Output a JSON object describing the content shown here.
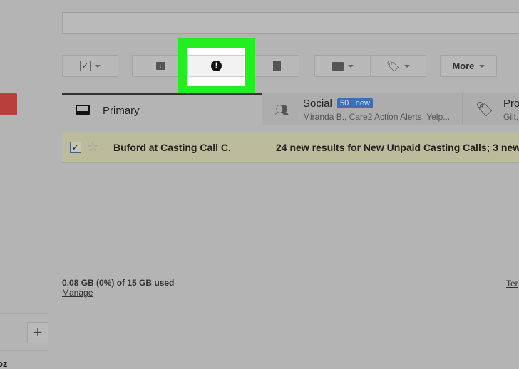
{
  "toolbar": {
    "more_label": "More"
  },
  "tabs": [
    {
      "label": "Primary"
    },
    {
      "label": "Social",
      "badge": "50+ new",
      "subtitle": "Miranda B., Care2 Action Alerts, Yelp..."
    },
    {
      "label": "Pro",
      "subtitle": "Gilt,"
    }
  ],
  "email": {
    "sender": "Buford at Casting Call C.",
    "subject": "24 new results for New Unpaid Casting Calls; 3 new"
  },
  "footer": {
    "storage": "0.08 GB (0%) of 15 GB used",
    "manage": "Manage",
    "terms": "Ter"
  },
  "sidebar": {
    "cut_text": "pz"
  },
  "colors": {
    "highlight": "#22ee22",
    "badge": "#3d6fb8",
    "compose": "#b8403a",
    "selected_row": "#bcbb9c"
  }
}
